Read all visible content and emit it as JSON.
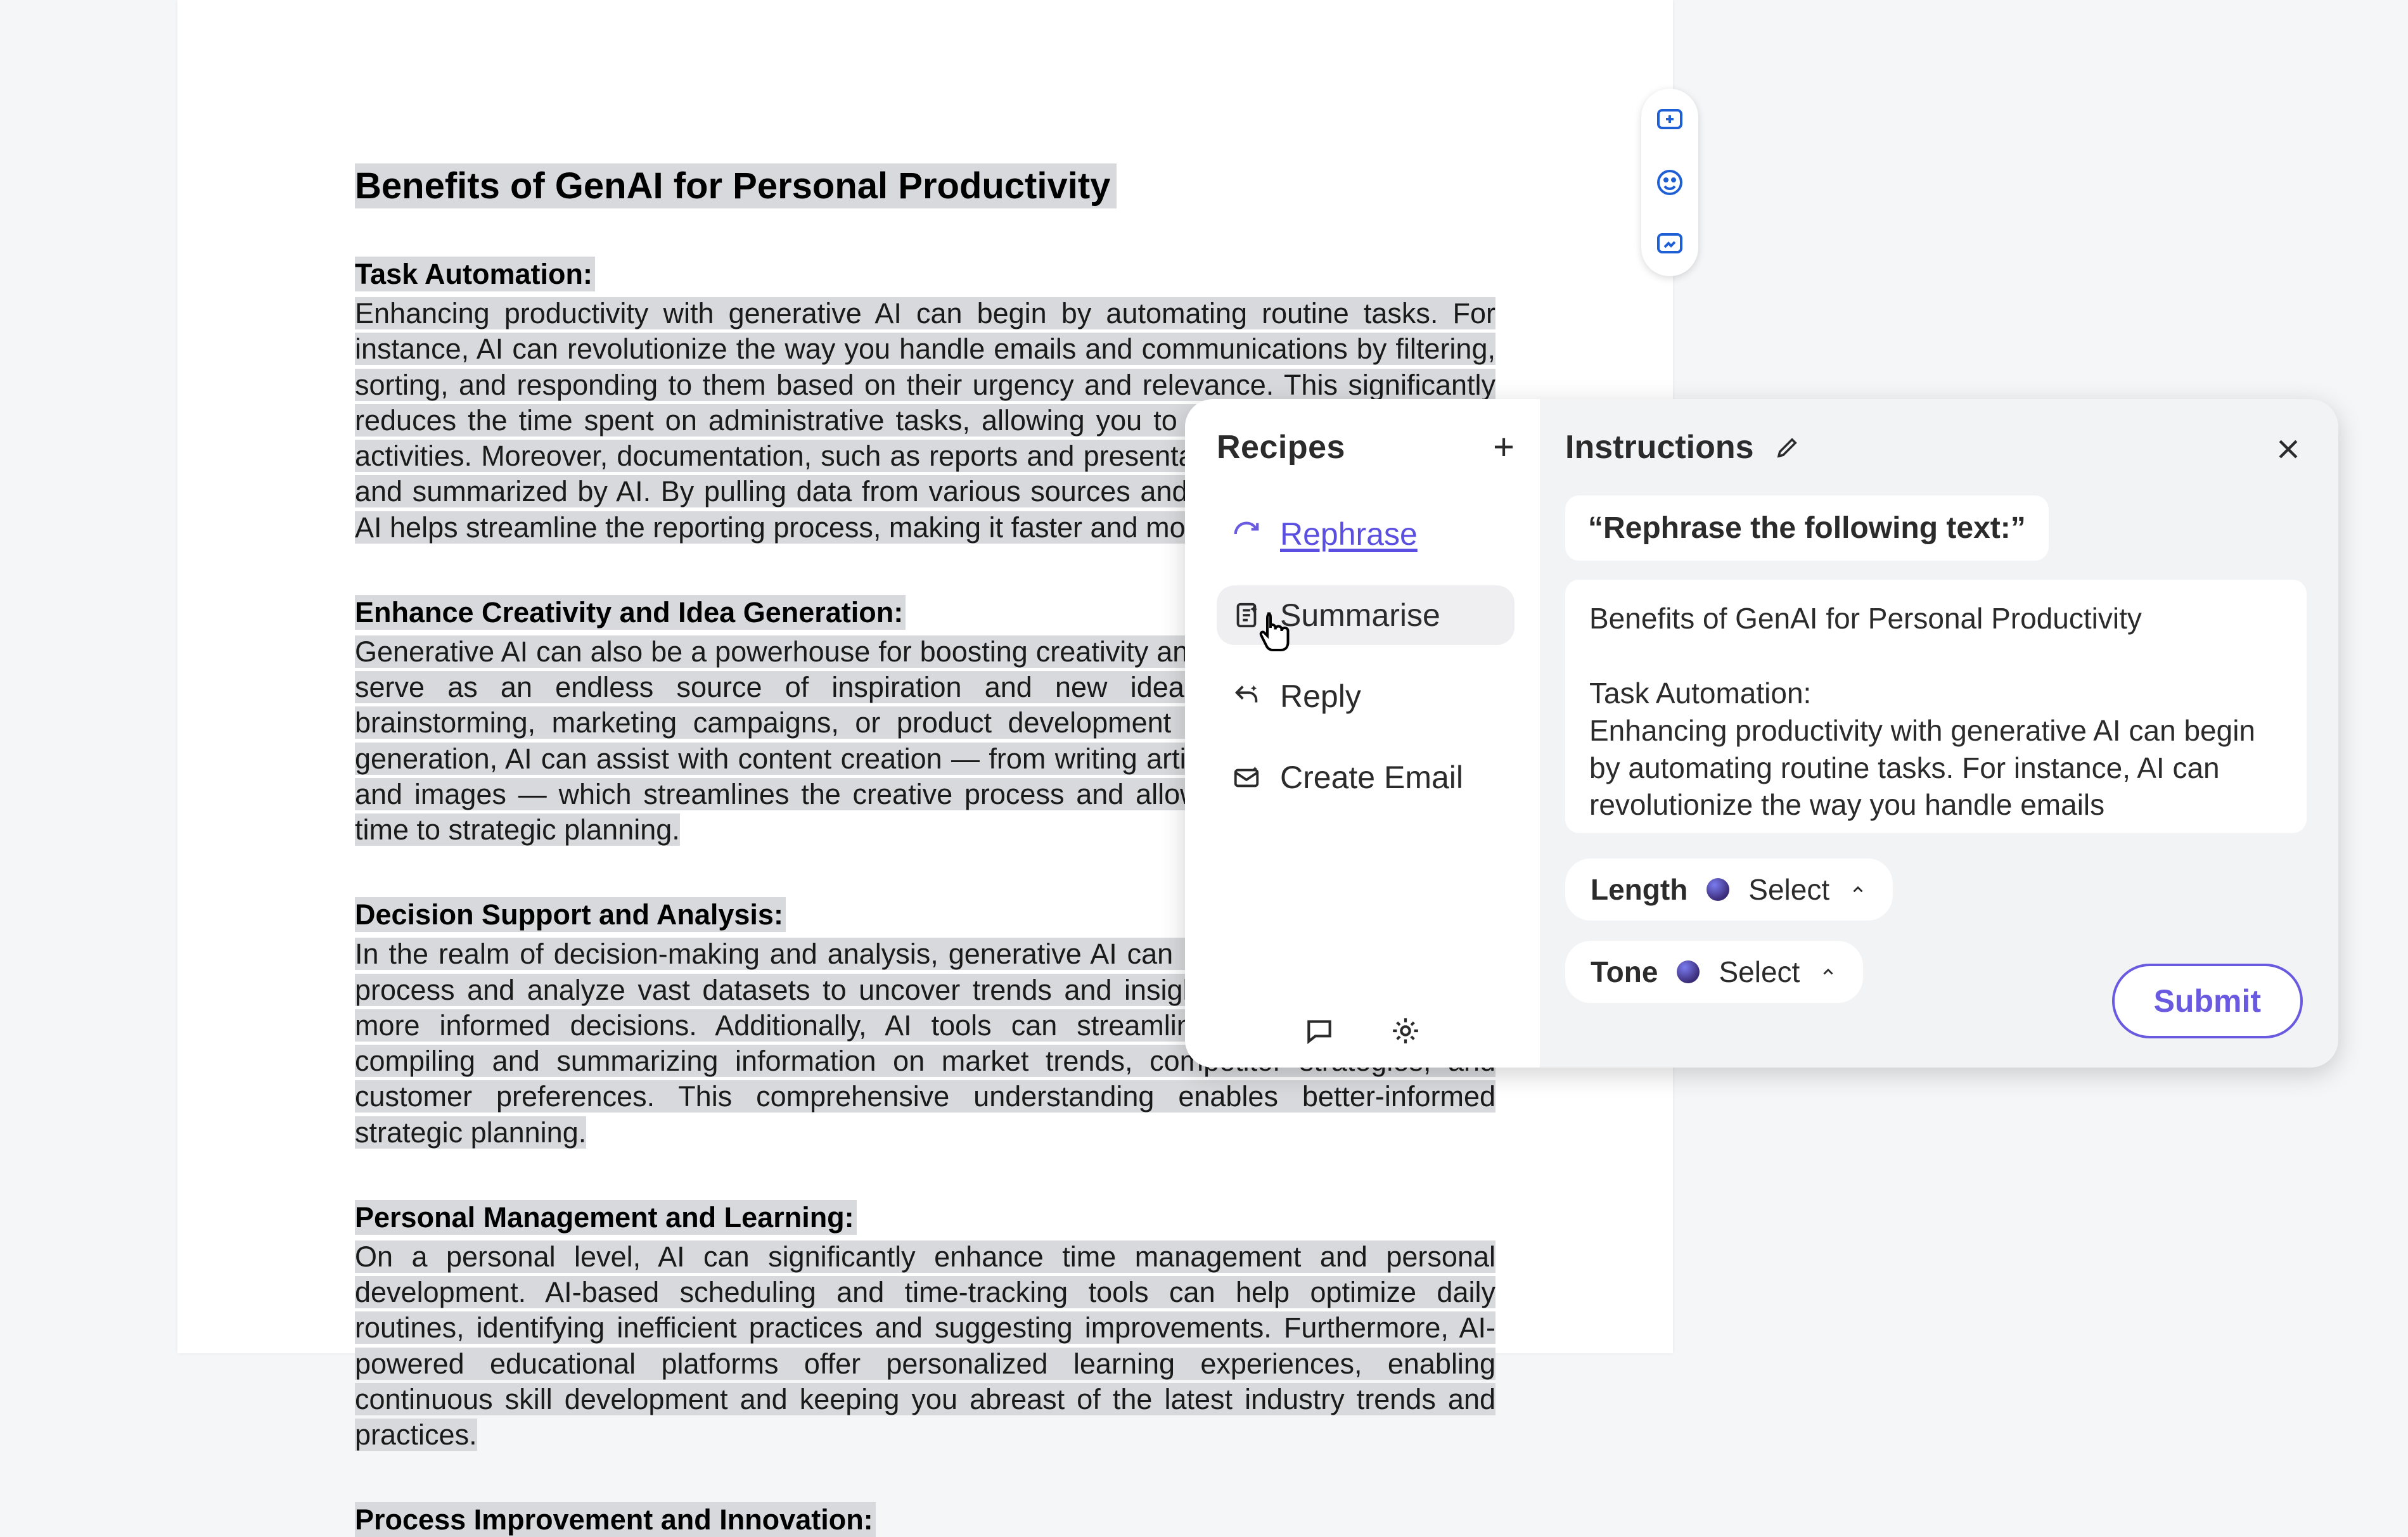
{
  "document": {
    "title": "Benefits of GenAI for Personal Productivity",
    "sections": [
      {
        "heading": "Task Automation:",
        "body": "Enhancing productivity with generative AI can begin by automating routine tasks. For instance, AI can revolutionize the way you handle emails and communications by filtering, sorting, and responding to them based on their urgency and relevance. This significantly reduces the time spent on administrative tasks, allowing you to focus on more strategic activities. Moreover, documentation, such as reports and presentations, can be generated and summarized by AI. By pulling data from various sources and organizing it effectively, AI helps streamline the reporting process, making it faster and more efficient."
      },
      {
        "heading": "Enhance Creativity and Idea Generation:",
        "body": "Generative AI can also be a powerhouse for boosting creativity and idea generation. It can serve as an endless source of inspiration and new ideas, whether for project brainstorming, marketing campaigns, or product development initiatives. Beyond idea generation, AI can assist with content creation — from writing articles to producing videos and images — which streamlines the creative process and allows you to allocate more time to strategic planning."
      },
      {
        "heading": "Decision Support and Analysis:",
        "body": "In the realm of decision-making and analysis, generative AI can be transformative. It can process and analyze vast datasets to uncover trends and insights, aiding in faster and more informed decisions. Additionally, AI tools can streamline market research by compiling and summarizing information on market trends, competitor strategies, and customer preferences. This comprehensive understanding enables better-informed strategic planning."
      },
      {
        "heading": "Personal Management and Learning:",
        "body": "On a personal level, AI can significantly enhance time management and personal development. AI-based scheduling and time-tracking tools can help optimize daily routines, identifying inefficient practices and suggesting improvements. Furthermore, AI-powered educational platforms offer personalized learning experiences, enabling continuous skill development and keeping you abreast of the latest industry trends and practices."
      },
      {
        "heading": "Process Improvement and Innovation:",
        "body": ""
      }
    ]
  },
  "mini_toolbar": {
    "add_comment_tooltip": "Add comment",
    "emoji_tooltip": "Add reaction",
    "suggest_tooltip": "Suggest edits"
  },
  "panel": {
    "recipes": {
      "title": "Recipes",
      "add_label": "+",
      "items": [
        {
          "label": "Rephrase",
          "icon": "refresh-icon",
          "active": true
        },
        {
          "label": "Summarise",
          "icon": "document-sparkle-icon",
          "hover": true
        },
        {
          "label": "Reply",
          "icon": "reply-sparkle-icon"
        },
        {
          "label": "Create Email",
          "icon": "email-sparkle-icon"
        }
      ],
      "footer": {
        "chat_label": "Chat",
        "settings_label": "Settings"
      }
    },
    "instructions": {
      "title": "Instructions",
      "edit_label": "Edit",
      "close_label": "Close",
      "prompt": "“Rephrase the following text:”",
      "context": "Benefits of GenAI for Personal Productivity\n\nTask Automation:\nEnhancing productivity with generative AI can begin by automating routine tasks. For instance, AI can revolutionize the way you handle emails",
      "length": {
        "label": "Length",
        "value": "Select"
      },
      "tone": {
        "label": "Tone",
        "value": "Select"
      },
      "submit_label": "Submit"
    }
  }
}
